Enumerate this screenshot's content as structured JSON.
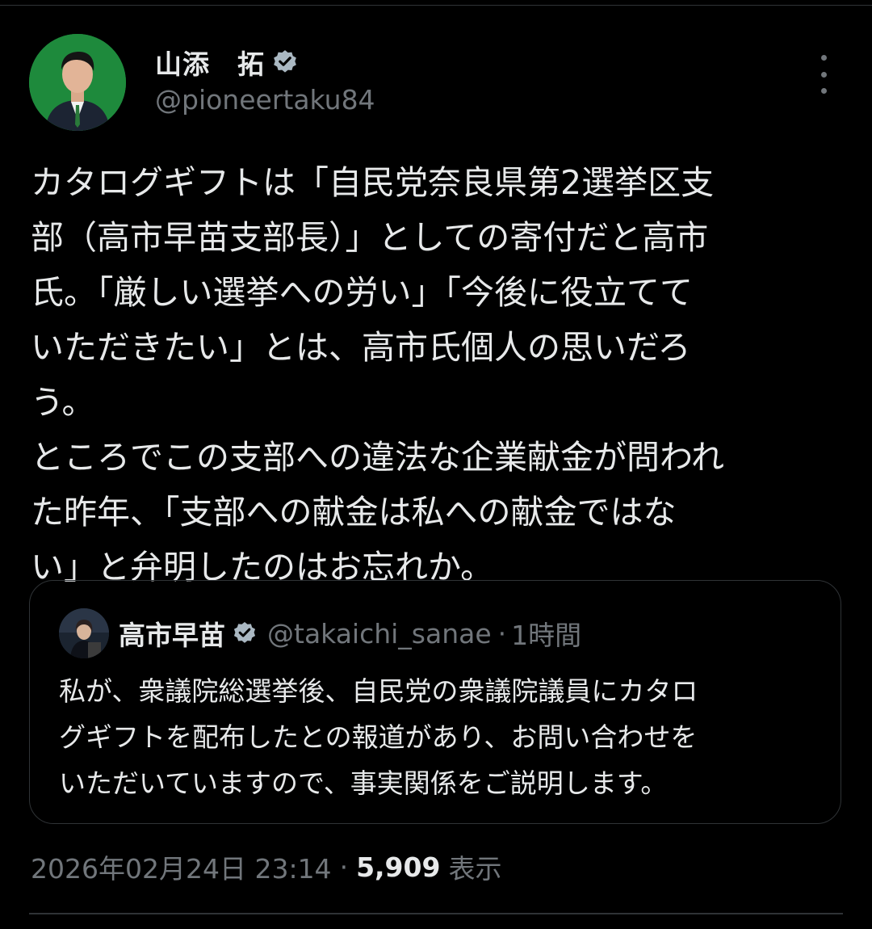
{
  "colors": {
    "background": "#000000",
    "primary_text": "#e7e9ea",
    "secondary_text": "#71767b",
    "border": "#2f3336",
    "avatar_bg": "#1e8a3c",
    "verified_badge": "#aab8c2"
  },
  "tweet": {
    "author": {
      "name": "山添　拓",
      "handle": "@pioneertaku84",
      "verified": true,
      "avatar_icon": "profile-photo",
      "verified_icon": "verified-badge-icon"
    },
    "more_icon": "more-options-icon",
    "body_lines": [
      "カタログギフトは「自民党奈良県第2選挙区支",
      "部（高市早苗支部長）」としての寄付だと高市",
      "氏。「厳しい選挙への労い」「今後に役立てて",
      "いただきたい」とは、高市氏個人の思いだろ",
      "う。",
      "ところでこの支部への違法な企業献金が問われ",
      "た昨年、「支部への献金は私への献金ではな",
      "い」と弁明したのはお忘れか。"
    ],
    "quote": {
      "author_name": "高市早苗",
      "verified": true,
      "handle": "@takaichi_sanae",
      "separator": "·",
      "time": "1時間",
      "body_lines": [
        "私が、衆議院総選挙後、自民党の衆議院議員にカタロ",
        "グギフトを配布したとの報道があり、お問い合わせを",
        "いただいていますので、事実関係をご説明します。"
      ]
    },
    "meta": {
      "timestamp": "2026年02月24日 23:14",
      "separator": "·",
      "views_count": "5,909",
      "views_label": "表示"
    }
  }
}
